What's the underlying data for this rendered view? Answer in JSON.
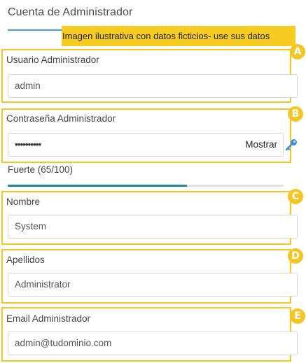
{
  "section_title": "Cuenta de Administrador",
  "banner_text": "Imagen ilustrativa con datos ficticios- use sus datos",
  "fields": [
    {
      "badge": "A",
      "label": "Usuario Administrador",
      "value": "admin"
    },
    {
      "badge": "B",
      "label": "Contraseña Administrador",
      "value": "••••••••••",
      "show_label": "Mostrar",
      "icon": "key-icon"
    },
    {
      "badge": "C",
      "label": "Nombre",
      "value": "System"
    },
    {
      "badge": "D",
      "label": "Apellidos",
      "value": "Administrator"
    },
    {
      "badge": "E",
      "label": "Email Administrador",
      "value": "admin@tudominio.com"
    }
  ],
  "password_strength": {
    "label": "Fuerte (65/100)",
    "score": 65,
    "max": 100
  },
  "colors": {
    "accent": "#3ea3dc",
    "highlight": "#f3c623",
    "banner": "#f7cc22",
    "strength": "#1b8a96"
  }
}
